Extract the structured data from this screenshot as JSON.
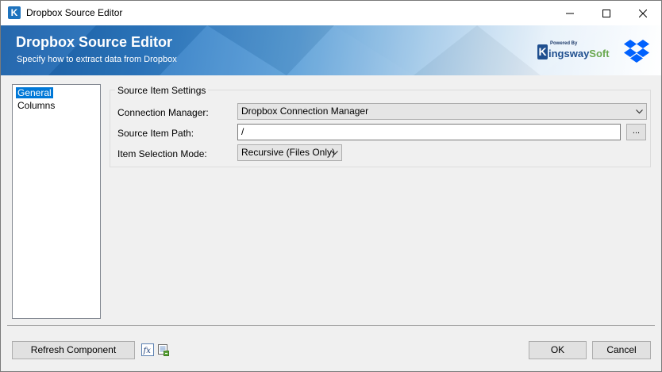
{
  "window": {
    "title": "Dropbox Source Editor",
    "icon": "kingsway-k-icon",
    "controls": [
      "minimize-icon",
      "maximize-icon",
      "close-icon"
    ]
  },
  "banner": {
    "title": "Dropbox Source Editor",
    "subtitle": "Specify how to extract data from Dropbox",
    "logo": {
      "powered_by": "Powered By",
      "k_letter": "K",
      "name_main": "ingsway",
      "name_accent": "Soft"
    },
    "dropbox_icon": "dropbox-icon"
  },
  "nav": {
    "items": [
      {
        "label": "General",
        "selected": true
      },
      {
        "label": "Columns",
        "selected": false
      }
    ]
  },
  "settings": {
    "group_title": "Source Item Settings",
    "connection_manager": {
      "label": "Connection Manager:",
      "value": "Dropbox Connection Manager"
    },
    "source_item_path": {
      "label": "Source Item Path:",
      "value": "/",
      "browse_label": "..."
    },
    "item_selection_mode": {
      "label": "Item Selection Mode:",
      "value": "Recursive (Files Only)"
    }
  },
  "footer": {
    "refresh_label": "Refresh Component",
    "expression_icon": "fx-icon",
    "variables_icon": "variables-icon",
    "ok_label": "OK",
    "cancel_label": "Cancel"
  },
  "colors": {
    "selection": "#0078d7",
    "banner_start": "#1a5fa8",
    "banner_end": "#ffffff",
    "dropbox_blue": "#0061fe"
  }
}
